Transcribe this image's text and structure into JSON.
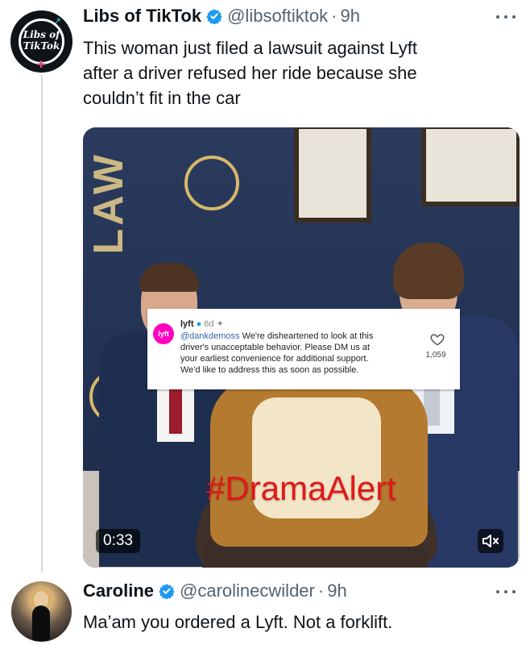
{
  "tweet": {
    "author_name": "Libs of TikTok",
    "handle": "@libsoftiktok",
    "separator": "·",
    "time": "9h",
    "avatar_text": [
      "Libs of",
      "TikTok"
    ],
    "text_lines": [
      "This woman just filed a lawsuit against Lyft",
      "after a driver refused her ride because she",
      "couldn’t fit in the car"
    ],
    "media": {
      "overlay_card": {
        "logo_text": "lyft",
        "account": "lyft",
        "age": "6d",
        "mention": "@dankdemoss",
        "lines": [
          " We're disheartened to look at this",
          "driver's unacceptable behavior. Please DM us at",
          "your earliest convenience for additional support.",
          "We'd like to address this as soon as possible."
        ],
        "likes": "1,059"
      },
      "background_text": "LAW",
      "hashtag": "#DramaAlert",
      "duration": "0:33",
      "mute_icon": "speaker-muted-icon"
    }
  },
  "reply": {
    "author_name": "Caroline",
    "handle": "@carolinecwilder",
    "separator": "·",
    "time": "9h",
    "text": "Ma’am you ordered a Lyft. Not a forklift."
  },
  "colors": {
    "verified": "#1d9bf0",
    "secondary_text": "#536471",
    "thread_line": "#cfd9de",
    "lyft_pink": "#ff00bf",
    "drama_red": "#e01818"
  }
}
